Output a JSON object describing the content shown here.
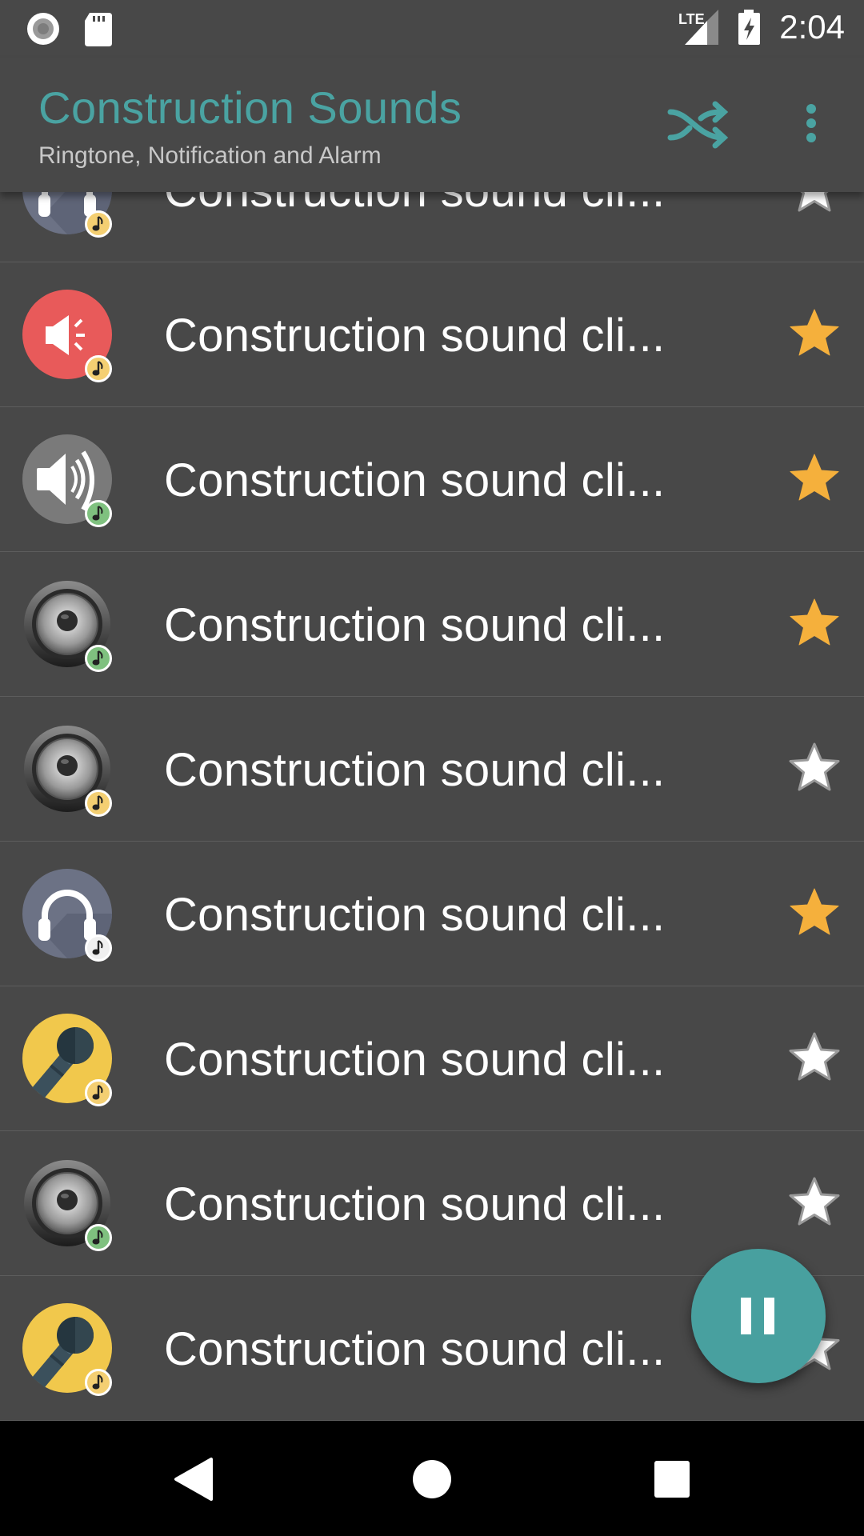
{
  "status_bar": {
    "left_icons": [
      "record-icon",
      "sd-card-icon"
    ],
    "network_label": "LTE",
    "battery_state": "charging",
    "time": "2:04"
  },
  "app_bar": {
    "title": "Construction Sounds",
    "subtitle": "Ringtone, Notification and Alarm",
    "actions": [
      "shuffle-icon",
      "more-vert-icon"
    ]
  },
  "colors": {
    "accent": "#4aa3a2",
    "fab": "#48a09f",
    "background": "#484848",
    "star_favorite": "#f5b03c",
    "star_empty": "#ffffff",
    "badge_yellow": "#f4cf72",
    "badge_green": "#7fc17f",
    "badge_white": "#f0f0f0"
  },
  "sounds": [
    {
      "title": "Construction sound cli...",
      "icon": "headphones-icon",
      "badge": "yellow",
      "favorite": false
    },
    {
      "title": "Construction sound cli...",
      "icon": "megaphone-icon",
      "badge": "yellow",
      "favorite": true
    },
    {
      "title": "Construction sound cli...",
      "icon": "volume-icon",
      "badge": "green",
      "favorite": true
    },
    {
      "title": "Construction sound cli...",
      "icon": "speaker-icon",
      "badge": "green",
      "favorite": true
    },
    {
      "title": "Construction sound cli...",
      "icon": "speaker-icon",
      "badge": "yellow",
      "favorite": false
    },
    {
      "title": "Construction sound cli...",
      "icon": "headphones-icon",
      "badge": "white",
      "favorite": true
    },
    {
      "title": "Construction sound cli...",
      "icon": "microphone-icon",
      "badge": "yellow",
      "favorite": false
    },
    {
      "title": "Construction sound cli...",
      "icon": "speaker-icon",
      "badge": "green",
      "favorite": false
    },
    {
      "title": "Construction sound cli...",
      "icon": "microphone-icon",
      "badge": "yellow",
      "favorite": false
    }
  ],
  "fab": {
    "icon": "pause-icon",
    "state": "playing"
  },
  "nav_bar": {
    "buttons": [
      "back-icon",
      "home-icon",
      "recents-icon"
    ]
  }
}
